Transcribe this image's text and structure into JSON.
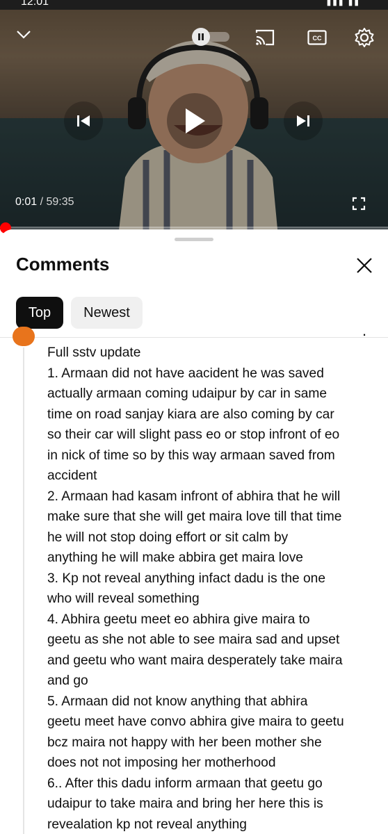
{
  "status_bar": {
    "clock": "12:01",
    "system": "▮▮▮ ▮▮"
  },
  "player": {
    "current_time": "0:01",
    "separator": " / ",
    "duration": "59:35",
    "progress_fraction": 0.0003,
    "accent_color": "#ff0000",
    "icons": [
      "chevron-down-icon",
      "pause-icon",
      "cast-icon",
      "cc-icon",
      "gear-icon",
      "previous-icon",
      "play-icon",
      "next-icon",
      "fullscreen-icon"
    ]
  },
  "comments_panel": {
    "title": "Comments",
    "chips": [
      {
        "label": "Top",
        "selected": true
      },
      {
        "label": "Newest",
        "selected": false
      }
    ],
    "comment": {
      "avatar_color": "#e8741c",
      "lines": [
        "Full sstv update",
        "1. Armaan did not have aacident he was saved",
        "actually armaan coming udaipur by car in same",
        "time on road sanjay kiara are also coming by car",
        "so their car will slight pass eo or stop infront of eo",
        "in nick of time so by this way armaan saved from",
        "accident",
        "2. Armaan had kasam infront of abhira that he will",
        "make sure that she will get maira love till that time",
        "he will not stop doing effort or sit calm by",
        "anything he will make abbira get maira love",
        "3. Kp not reveal anything infact dadu is the one",
        "who will reveal something",
        "4. Abhira geetu meet eo abhira give maira to",
        "geetu as she not able to see maira sad and upset",
        "and geetu who want maira desperately take maira",
        "and go",
        "5. Armaan did not know anything that abhira",
        "geetu meet have convo abhira give maira to geetu",
        "bcz maira not happy with her been mother she",
        "does not not imposing her motherhood",
        "6.. After this dadu inform armaan that geetu go",
        "udaipur to take maira and bring her here this is",
        "revealation kp not reveal anything"
      ]
    }
  }
}
